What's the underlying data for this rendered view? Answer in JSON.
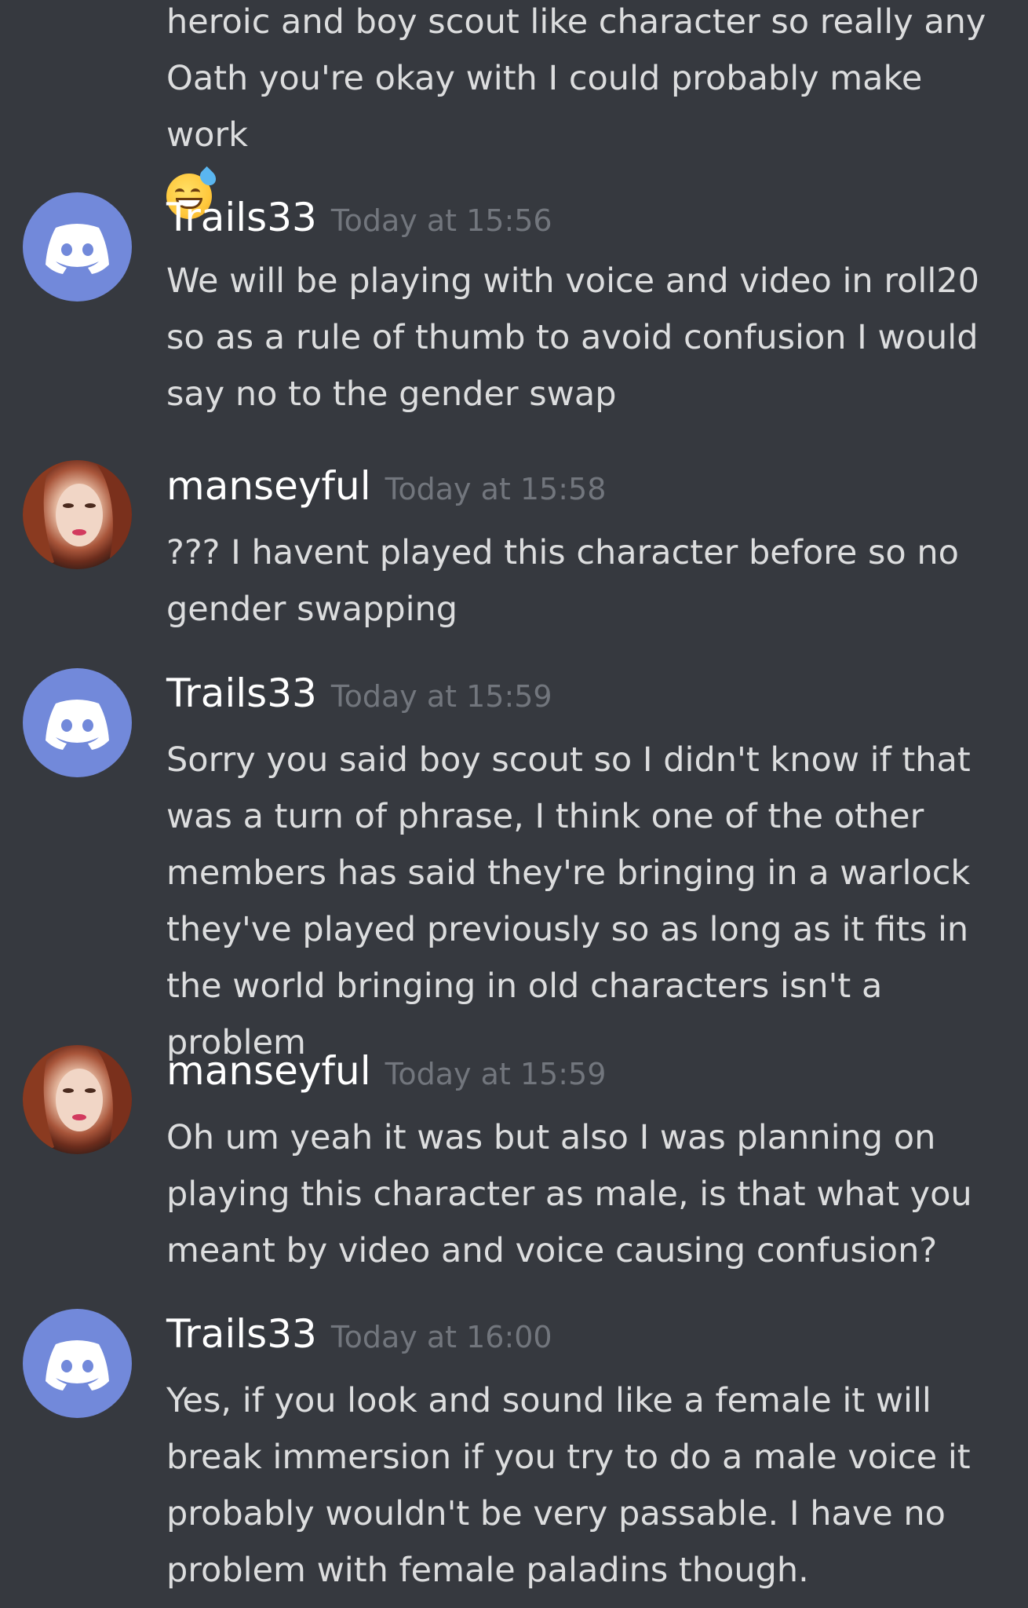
{
  "previous_message": {
    "text": "heroic and boy scout like character so really any Oath you're okay with I could probably make work",
    "emoji": "sweat-smile"
  },
  "messages": [
    {
      "username": "Trails33",
      "timestamp": "Today at 15:56",
      "avatar": "discord-default",
      "text": "We will be playing with voice and video in roll20 so as a rule of thumb to avoid confusion I would say no to the gender swap"
    },
    {
      "username": "manseyful",
      "timestamp": "Today at 15:58",
      "avatar": "user-photo",
      "text": "??? I havent played this character before so no gender swapping"
    },
    {
      "username": "Trails33",
      "timestamp": "Today at 15:59",
      "avatar": "discord-default",
      "text": "Sorry you said boy scout so I didn't know if that was a turn of phrase, I think one of the other members has said they're bringing in a warlock they've played previously so as long as it fits in the world bringing in old characters isn't a problem"
    },
    {
      "username": "manseyful",
      "timestamp": "Today at 15:59",
      "avatar": "user-photo",
      "text": "Oh um yeah it was but also I was planning on playing this character as male, is that what you meant by video and voice causing confusion?"
    },
    {
      "username": "Trails33",
      "timestamp": "Today at 16:00",
      "avatar": "discord-default",
      "text": "Yes, if you look and sound like a female it will break immersion if you try to do a male voice it probably wouldn't be very passable. I have no problem with female paladins though."
    }
  ],
  "colors": {
    "background": "#36393f",
    "username": "#ffffff",
    "timestamp": "#72767d",
    "text": "#dcddde",
    "discord_avatar": "#7289da"
  }
}
